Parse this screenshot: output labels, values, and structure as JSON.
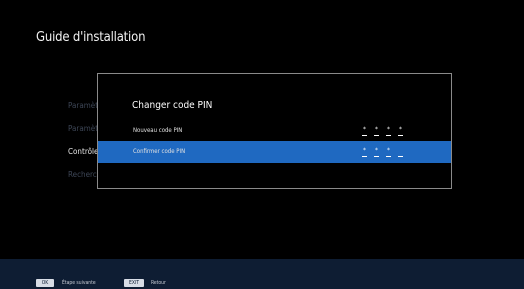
{
  "page": {
    "title": "Guide d'installation"
  },
  "side_menu": {
    "items": [
      {
        "label": "Paramèt",
        "state": "dim"
      },
      {
        "label": "Paramèt",
        "state": "dim"
      },
      {
        "label": "Contrôle",
        "state": "active"
      },
      {
        "label": "Recherch",
        "state": "dim"
      }
    ]
  },
  "dialog": {
    "title": "Changer code PIN",
    "rows": [
      {
        "label": "Nouveau code PIN",
        "digits": [
          "*",
          "*",
          "*",
          "*"
        ],
        "selected": false
      },
      {
        "label": "Confirmer code PIN",
        "digits": [
          "*",
          "*",
          "*",
          ""
        ],
        "selected": true
      }
    ]
  },
  "footer": {
    "ok_key": "OK",
    "ok_label": "Étape suivante",
    "exit_key": "EXIT",
    "exit_label": "Retour"
  },
  "colors": {
    "background": "#000000",
    "highlight": "#1f69c1",
    "footer": "#0e1d33",
    "dialog_border": "#8a8a8a"
  }
}
